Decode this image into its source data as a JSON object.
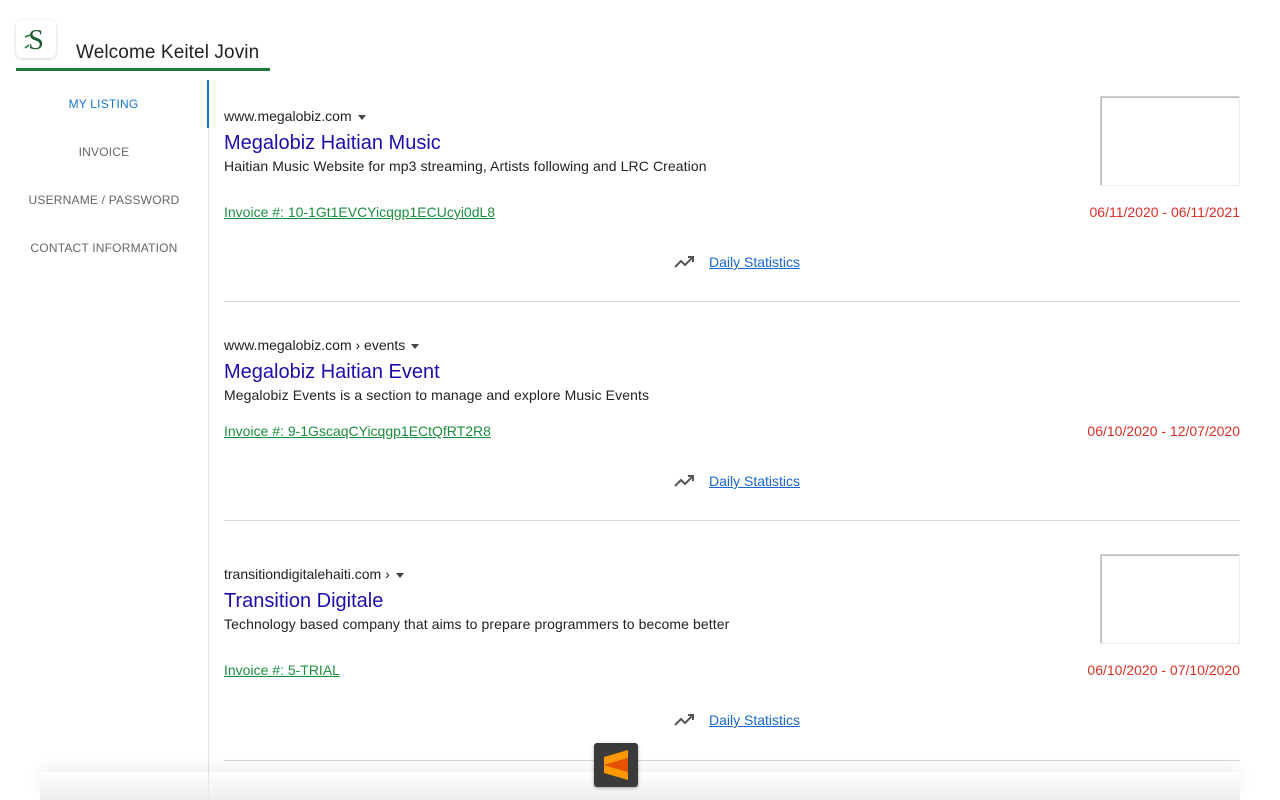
{
  "header": {
    "welcome_text": "Welcome Keitel Jovin",
    "logo_letter": "S",
    "accent_color": "#1e7a3a"
  },
  "sidebar": {
    "items": [
      {
        "label": "MY LISTING",
        "active": true
      },
      {
        "label": "INVOICE",
        "active": false
      },
      {
        "label": "USERNAME / PASSWORD",
        "active": false
      },
      {
        "label": "CONTACT INFORMATION",
        "active": false
      }
    ],
    "active_color": "#1976d2"
  },
  "listings": [
    {
      "breadcrumb": "www.megalobiz.com",
      "title": "Megalobiz Haitian Music",
      "description": "Haitian Music Website for mp3 streaming, Artists following and LRC Creation",
      "invoice": "Invoice #: 10-1Gt1EVCYicqgp1ECUcyi0dL8",
      "dates": "06/11/2020 - 06/11/2021",
      "stats_label": "Daily Statistics",
      "has_thumbnail": true
    },
    {
      "breadcrumb": "www.megalobiz.com › events",
      "title": "Megalobiz Haitian Event",
      "description": "Megalobiz Events is a section to manage and explore Music Events",
      "invoice": "Invoice #: 9-1GscaqCYicqgp1ECtQfRT2R8",
      "dates": "06/10/2020 - 12/07/2020",
      "stats_label": "Daily Statistics",
      "has_thumbnail": false
    },
    {
      "breadcrumb": "transitiondigitalehaiti.com ›",
      "title": "Transition Digitale",
      "description": "Technology based company that aims to prepare programmers to become better",
      "invoice": "Invoice #: 5-TRIAL",
      "dates": "06/10/2020 - 07/10/2020",
      "stats_label": "Daily Statistics",
      "has_thumbnail": true
    }
  ],
  "colors": {
    "title_link": "#1a0dab",
    "invoice_link": "#1e8e3e",
    "dates": "#d93025",
    "stats_link": "#1967d2"
  },
  "dock": {
    "app_icon": "sublime-text-icon",
    "app_color": "#ff9800"
  },
  "icons": {
    "trend": "trending-up-icon",
    "caret": "caret-down-icon"
  }
}
